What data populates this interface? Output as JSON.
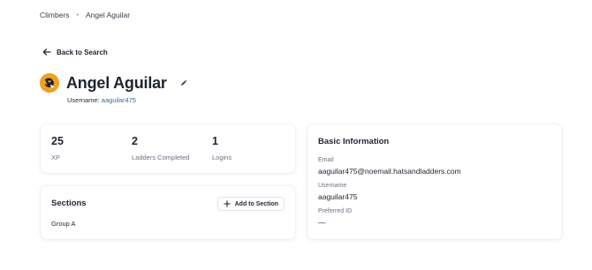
{
  "breadcrumb": {
    "root": "Climbers",
    "separator": "•",
    "current": "Angel Aguilar"
  },
  "back_link": {
    "icon": "arrow-left-icon",
    "label": "Back to Search"
  },
  "profile": {
    "name": "Angel Aguilar",
    "username_label": "Username:",
    "username_value": "aaguilar475",
    "avatar_color": "#f0a020",
    "edit_icon": "pencil-icon"
  },
  "stats": [
    {
      "value": "25",
      "label": "XP"
    },
    {
      "value": "2",
      "label": "Ladders Completed"
    },
    {
      "value": "1",
      "label": "Logins"
    }
  ],
  "sections": {
    "title": "Sections",
    "add_button_label": "Add to Section",
    "add_icon": "plus-icon",
    "items": [
      "Group A"
    ]
  },
  "basic_info": {
    "title": "Basic Information",
    "fields": [
      {
        "label": "Email",
        "value": "aaguilar475@noemail.hatsandladders.com"
      },
      {
        "label": "Username",
        "value": "aaguilar475"
      },
      {
        "label": "Preferred ID",
        "value": "—"
      }
    ]
  }
}
